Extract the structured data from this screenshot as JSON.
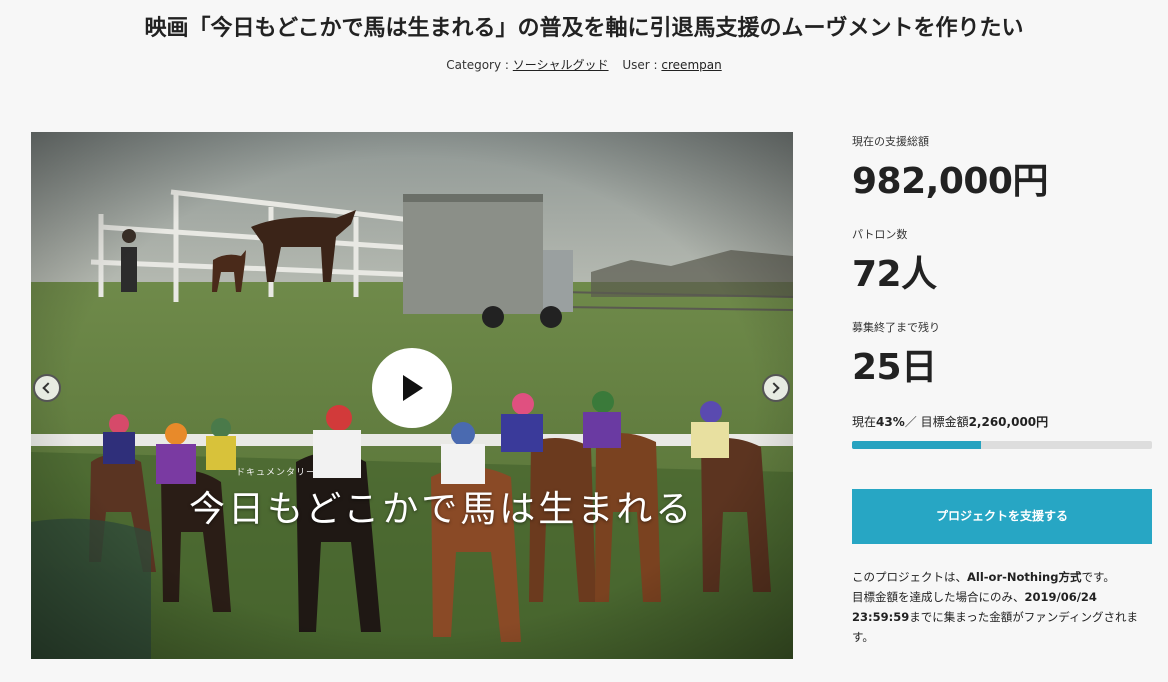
{
  "project": {
    "title": "映画「今日もどこかで馬は生まれる」の普及を軸に引退馬支援のムーヴメントを作りたい",
    "category_label": "Category : ",
    "category": "ソーシャルグッド",
    "user_label": "User : ",
    "user": "creempan"
  },
  "hero": {
    "doc_label": "ドキュメンタリー映画",
    "film_title": "今日もどこかで馬は生まれる",
    "play_icon": "play-icon",
    "prev_icon": "chevron-left-icon",
    "next_icon": "chevron-right-icon"
  },
  "stats": {
    "total_label": "現在の支援総額",
    "total_value": "982,000円",
    "patrons_label": "パトロン数",
    "patrons_value": "72人",
    "remaining_label": "募集終了まで残り",
    "remaining_value": "25日",
    "progress_prefix": "現在",
    "progress_percent": "43%",
    "progress_sep": "／ 目標金額",
    "goal_amount": "2,260,000円",
    "progress_fraction": 0.43
  },
  "support_button": "プロジェクトを支援する",
  "note": {
    "part1": "このプロジェクトは、",
    "mode": "All-or-Nothing方式",
    "part2": "です。",
    "part3": "目標金額を達成した場合にのみ、",
    "deadline_date": "2019/06/24",
    "deadline_time": "23:59:59",
    "part4": "までに集まった金額がファンディングされます。"
  },
  "colors": {
    "accent": "#27a6c4",
    "background": "#f7f7f7",
    "progress_track": "#dddddd"
  }
}
